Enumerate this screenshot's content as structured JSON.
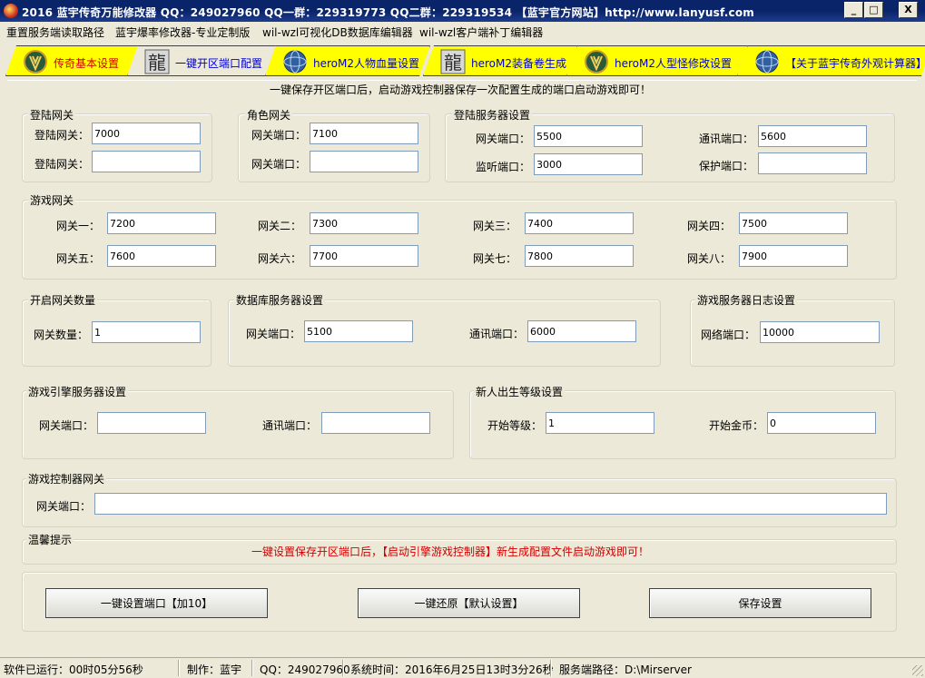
{
  "window": {
    "title": "2016 蓝宇传奇万能修改器  QQ：249027960 QQ一群：229319773 QQ二群：229319534  【蓝宇官方网站】http://www.lanyusf.com",
    "min_label": "_",
    "max_label": "□",
    "close_label": "X"
  },
  "menu": [
    "重置服务端读取路径",
    "蓝宇爆率修改器-专业定制版",
    "wil-wzl可视化DB数据库编辑器",
    "wil-wzl客户端补丁编辑器"
  ],
  "tabs": [
    {
      "label": "传奇基本设置",
      "icon": "warcraft-logo-icon"
    },
    {
      "label": "一键开区端口配置",
      "icon": "dragon-glyph-icon"
    },
    {
      "label": "heroM2人物血量设置",
      "icon": "globe-orb-icon"
    },
    {
      "label": "heroM2装备卷生成",
      "icon": "dragon-glyph-icon"
    },
    {
      "label": "heroM2人型怪修改设置",
      "icon": "warcraft-logo-icon"
    },
    {
      "label": "【关于蓝宇传奇外观计算器】",
      "icon": "globe-orb-icon"
    }
  ],
  "top_note": "一键保存开区端口后，启动游戏控制器保存一次配置生成的端口启动游戏即可！",
  "login_gate": {
    "title": "登陆网关",
    "label1": "登陆网关：",
    "value1": "7000",
    "label2": "登陆网关：",
    "value2": ""
  },
  "role_gate": {
    "title": "角色网关",
    "label1": "网关端口：",
    "value1": "7100",
    "label2": "网关端口：",
    "value2": ""
  },
  "login_server": {
    "title": "登陆服务器设置",
    "gate_port_label": "网关端口：",
    "gate_port": "5500",
    "listen_label": "监听端口：",
    "listen_port": "3000",
    "comm_label": "通讯端口：",
    "comm_port": "5600",
    "protect_label": "保护端口：",
    "protect_port": ""
  },
  "game_gate": {
    "title": "游戏网关",
    "gates": [
      {
        "label": "网关一：",
        "value": "7200"
      },
      {
        "label": "网关二：",
        "value": "7300"
      },
      {
        "label": "网关三：",
        "value": "7400"
      },
      {
        "label": "网关四：",
        "value": "7500"
      },
      {
        "label": "网关五：",
        "value": "7600"
      },
      {
        "label": "网关六：",
        "value": "7700"
      },
      {
        "label": "网关七：",
        "value": "7800"
      },
      {
        "label": "网关八：",
        "value": "7900"
      }
    ]
  },
  "gate_count": {
    "title": "开启网关数量",
    "label": "网关数量：",
    "value": "1"
  },
  "db_server": {
    "title": "数据库服务器设置",
    "gate_label": "网关端口：",
    "gate_port": "5100",
    "comm_label": "通讯端口：",
    "comm_port": "6000"
  },
  "log_server": {
    "title": "游戏服务器日志设置",
    "label": "网络端口：",
    "value": "10000"
  },
  "engine_server": {
    "title": "游戏引擎服务器设置",
    "gate_label": "网关端口：",
    "gate_port": "",
    "comm_label": "通讯端口：",
    "comm_port": ""
  },
  "newbie": {
    "title": "新人出生等级设置",
    "level_label": "开始等级：",
    "level": "1",
    "gold_label": "开始金币：",
    "gold": "0"
  },
  "controller_gate": {
    "title": "游戏控制器网关",
    "label": "网关端口：",
    "value": ""
  },
  "tips": {
    "title": "温馨提示",
    "text": "一键设置保存开区端口后，【启动引擎游戏控制器】新生成配置文件启动游戏即可！"
  },
  "buttons": {
    "set_ports": "一键设置端口【加10】",
    "restore": "一键还原【默认设置】",
    "save": "保存设置"
  },
  "status": {
    "uptime": "软件已运行：00时05分56秒",
    "author": "制作：蓝宇",
    "qq": "QQ：249027960",
    "system_time": "系统时间：2016年6月25日13时3分26秒",
    "server_path": "服务端路径：D:\\Mirserver"
  }
}
